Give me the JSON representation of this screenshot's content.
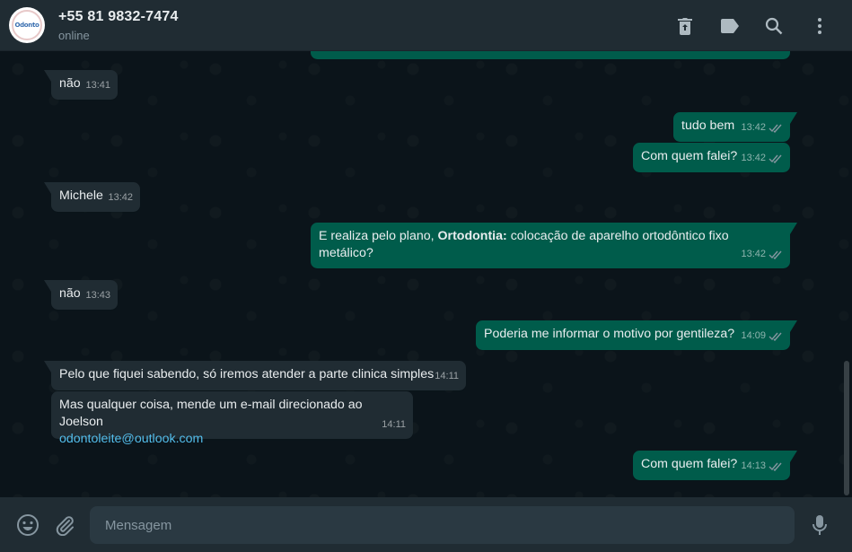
{
  "header": {
    "avatar_text": "Odonto",
    "contact_name": "+55 81 9832-7474",
    "status": "online",
    "icons": [
      "delete-icon",
      "label-icon",
      "search-icon",
      "menu-icon"
    ]
  },
  "messages": [
    {
      "dir": "in",
      "text": "não",
      "time": "13:41"
    },
    {
      "dir": "out",
      "text": "tudo bem",
      "time": "13:42"
    },
    {
      "dir": "out",
      "text": "Com quem falei?",
      "time": "13:42"
    },
    {
      "dir": "in",
      "text": "Michele",
      "time": "13:42"
    },
    {
      "dir": "out",
      "text_before": "E realiza pelo plano, ",
      "text_bold": "Ortodontia:",
      "text_after": " colocação de aparelho ortodôntico fixo metálico?",
      "time": "13:42"
    },
    {
      "dir": "in",
      "text": "não",
      "time": "13:43"
    },
    {
      "dir": "out",
      "text": "Poderia me informar o motivo por gentileza?",
      "time": "14:09"
    },
    {
      "dir": "in",
      "text": "Pelo que fiquei sabendo, só iremos atender a parte clinica simples",
      "time": "14:11"
    },
    {
      "dir": "in",
      "text": "Mas qualquer coisa, mende um e-mail direcionado ao Joelson",
      "link": "odontoleite@outlook.com",
      "time": "14:11"
    },
    {
      "dir": "out",
      "text": "Com quem falei?",
      "time": "14:13"
    }
  ],
  "composer": {
    "placeholder": "Mensagem"
  },
  "colors": {
    "header_bg": "#202c33",
    "chat_bg": "#0b141a",
    "incoming": "#202c33",
    "outgoing": "#005c4b",
    "link": "#53bdeb"
  }
}
